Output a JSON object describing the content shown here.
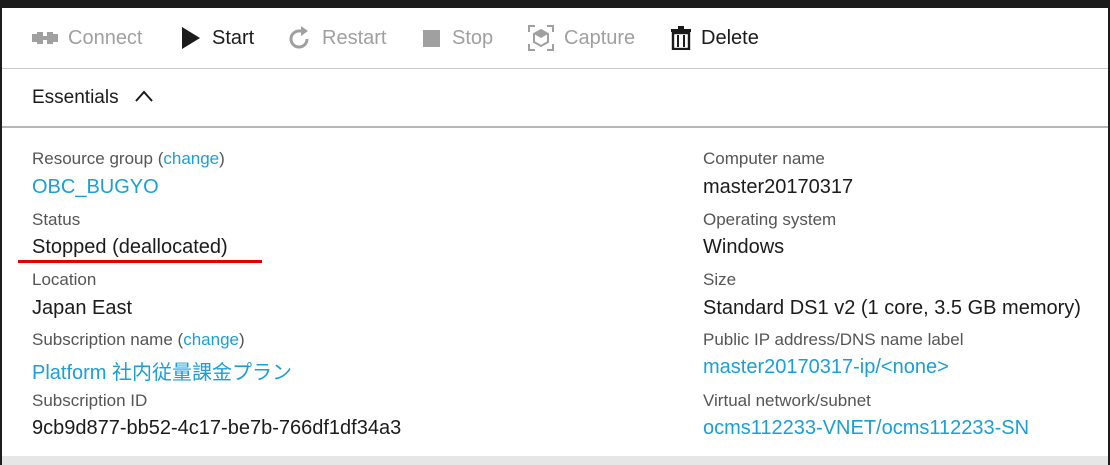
{
  "toolbar": {
    "connect": "Connect",
    "start": "Start",
    "restart": "Restart",
    "stop": "Stop",
    "capture": "Capture",
    "delete": "Delete"
  },
  "essentials": {
    "label": "Essentials"
  },
  "left": {
    "resource_group_label": "Resource group",
    "resource_group_change": "change",
    "resource_group_value": "OBC_BUGYO",
    "status_label": "Status",
    "status_value": "Stopped (deallocated)",
    "location_label": "Location",
    "location_value": "Japan East",
    "subscription_name_label": "Subscription name",
    "subscription_name_change": "change",
    "subscription_name_value": "Platform 社内従量課金プラン",
    "subscription_id_label": "Subscription ID",
    "subscription_id_value": "9cb9d877-bb52-4c17-be7b-766df1df34a3"
  },
  "right": {
    "computer_name_label": "Computer name",
    "computer_name_value": "master20170317",
    "os_label": "Operating system",
    "os_value": "Windows",
    "size_label": "Size",
    "size_value": "Standard DS1 v2 (1 core, 3.5 GB memory)",
    "public_ip_label": "Public IP address/DNS name label",
    "public_ip_value": "master20170317-ip/<none>",
    "vnet_label": "Virtual network/subnet",
    "vnet_value": "ocms112233-VNET/ocms112233-SN"
  },
  "colors": {
    "link": "#1a9fd8",
    "disabled": "#a0a0a0",
    "highlight_underline": "#e00000"
  },
  "icons": [
    "connect-icon",
    "play-icon",
    "restart-icon",
    "stop-icon",
    "capture-icon",
    "trash-icon",
    "chevron-up-icon"
  ]
}
